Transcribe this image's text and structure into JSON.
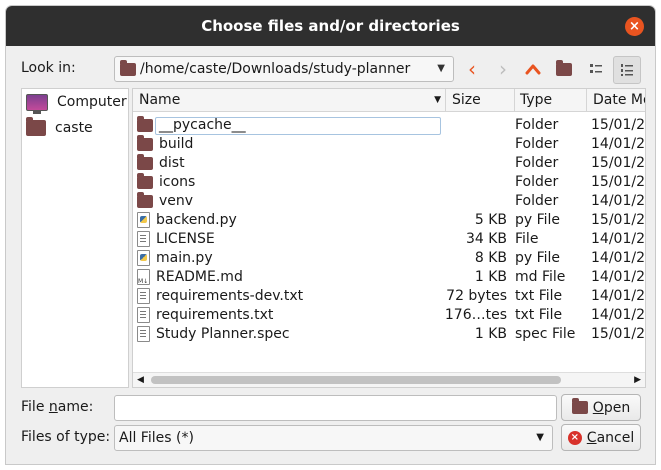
{
  "window": {
    "title": "Choose files and/or directories",
    "close_symbol": "×"
  },
  "look_in": {
    "label": "Look in:",
    "path": "/home/caste/Downloads/study-planner"
  },
  "sidebar": {
    "items": [
      {
        "label": "Computer",
        "icon": "computer-icon"
      },
      {
        "label": "caste",
        "icon": "folder-icon"
      }
    ]
  },
  "columns": {
    "name": "Name",
    "size": "Size",
    "type": "Type",
    "date": "Date Mo"
  },
  "files": [
    {
      "name": "__pycache__",
      "size": "",
      "type": "Folder",
      "date": "15/01/2",
      "icon": "folder"
    },
    {
      "name": "build",
      "size": "",
      "type": "Folder",
      "date": "14/01/2",
      "icon": "folder"
    },
    {
      "name": "dist",
      "size": "",
      "type": "Folder",
      "date": "15/01/2",
      "icon": "folder"
    },
    {
      "name": "icons",
      "size": "",
      "type": "Folder",
      "date": "15/01/2",
      "icon": "folder"
    },
    {
      "name": "venv",
      "size": "",
      "type": "Folder",
      "date": "14/01/2",
      "icon": "folder"
    },
    {
      "name": "backend.py",
      "size": "5 KB",
      "type": "py File",
      "date": "15/01/2",
      "icon": "py"
    },
    {
      "name": "LICENSE",
      "size": "34 KB",
      "type": "File",
      "date": "14/01/2",
      "icon": "text"
    },
    {
      "name": "main.py",
      "size": "8 KB",
      "type": "py File",
      "date": "14/01/2",
      "icon": "py"
    },
    {
      "name": "README.md",
      "size": "1 KB",
      "type": "md File",
      "date": "14/01/2",
      "icon": "md"
    },
    {
      "name": "requirements-dev.txt",
      "size": "72 bytes",
      "type": "txt File",
      "date": "14/01/2",
      "icon": "text"
    },
    {
      "name": "requirements.txt",
      "size": "176…tes",
      "type": "txt File",
      "date": "14/01/2",
      "icon": "text"
    },
    {
      "name": "Study Planner.spec",
      "size": "1 KB",
      "type": "spec File",
      "date": "15/01/2",
      "icon": "text"
    }
  ],
  "file_name": {
    "label_pre": "File ",
    "label_ul": "n",
    "label_post": "ame:",
    "value": ""
  },
  "files_of_type": {
    "label": "Files of type:",
    "value": "All Files (*)"
  },
  "buttons": {
    "open_ul": "O",
    "open_rest": "pen",
    "cancel_ul": "C",
    "cancel_rest": "ancel"
  },
  "colors": {
    "accent": "#e95420",
    "folder": "#7b4848"
  }
}
